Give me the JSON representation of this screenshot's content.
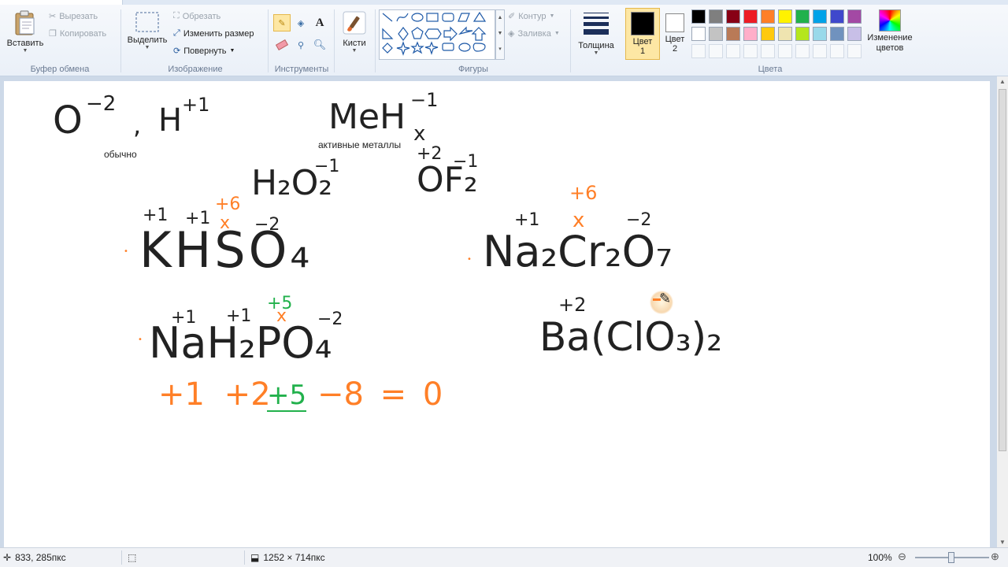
{
  "ribbon": {
    "clipboard": {
      "label": "Буфер обмена",
      "paste": "Вставить",
      "cut": "Вырезать",
      "copy": "Копировать"
    },
    "image": {
      "label": "Изображение",
      "select": "Выделить",
      "crop": "Обрезать",
      "resize": "Изменить размер",
      "rotate": "Повернуть"
    },
    "tools": {
      "label": "Инструменты"
    },
    "brushes": {
      "label": "Кисти"
    },
    "shapes": {
      "label": "Фигуры",
      "outline": "Контур",
      "fill": "Заливка"
    },
    "size": {
      "label": "Толщина"
    },
    "colors": {
      "label": "Цвета",
      "color1": "Цвет 1",
      "color2": "Цвет 2",
      "edit": "Изменение цветов",
      "palette_row1": [
        "#000000",
        "#7f7f7f",
        "#880015",
        "#ed1c24",
        "#ff7f27",
        "#fff200",
        "#22b14c",
        "#00a2e8",
        "#3f48cc",
        "#a349a4"
      ],
      "palette_row2": [
        "#ffffff",
        "#c3c3c3",
        "#b97a57",
        "#ffaec9",
        "#ffc90e",
        "#efe4b0",
        "#b5e61d",
        "#99d9ea",
        "#7092be",
        "#c8bfe7"
      ]
    }
  },
  "canvas": {
    "typed_notes": {
      "usually": "обычно",
      "active_metals": "активные металлы"
    },
    "handwriting": {
      "o": "O",
      "o_ox": "−2",
      "comma": ",",
      "h": "H",
      "h_ox": "+1",
      "me": "MeH",
      "me_sub": "x",
      "me_ox": "−1",
      "h2o2": "H₂O₂",
      "h2o2_ox": "−1",
      "of2": "OF₂",
      "of2_ox_o": "+2",
      "of2_ox_f": "−1",
      "khso4": "KHSO₄",
      "khso4_ox_k": "+1",
      "khso4_ox_h": "+1",
      "khso4_ox_s": "+6",
      "khso4_x": "x",
      "khso4_ox_o": "−2",
      "na2cr2o7": "Na₂Cr₂O₇",
      "na2cr2o7_ox_na": "+1",
      "na2cr2o7_ox_cr": "+6",
      "na2cr2o7_x": "x",
      "na2cr2o7_ox_o": "−2",
      "nah2po4": "NaH₂PO₄",
      "nah2po4_ox_na": "+1",
      "nah2po4_ox_h": "+1",
      "nah2po4_ox_p": "+5",
      "nah2po4_x": "x",
      "nah2po4_ox_o": "−2",
      "sum": "+1 +2",
      "sum_p": "+5",
      "sum_rest": "−8 = 0",
      "baclo3": "Ba(ClO₃)₂",
      "baclo3_ox_ba": "+2"
    }
  },
  "status": {
    "cursor_pos": "833, 285пкс",
    "canvas_size": "1252 × 714пкс",
    "zoom": "100%"
  }
}
